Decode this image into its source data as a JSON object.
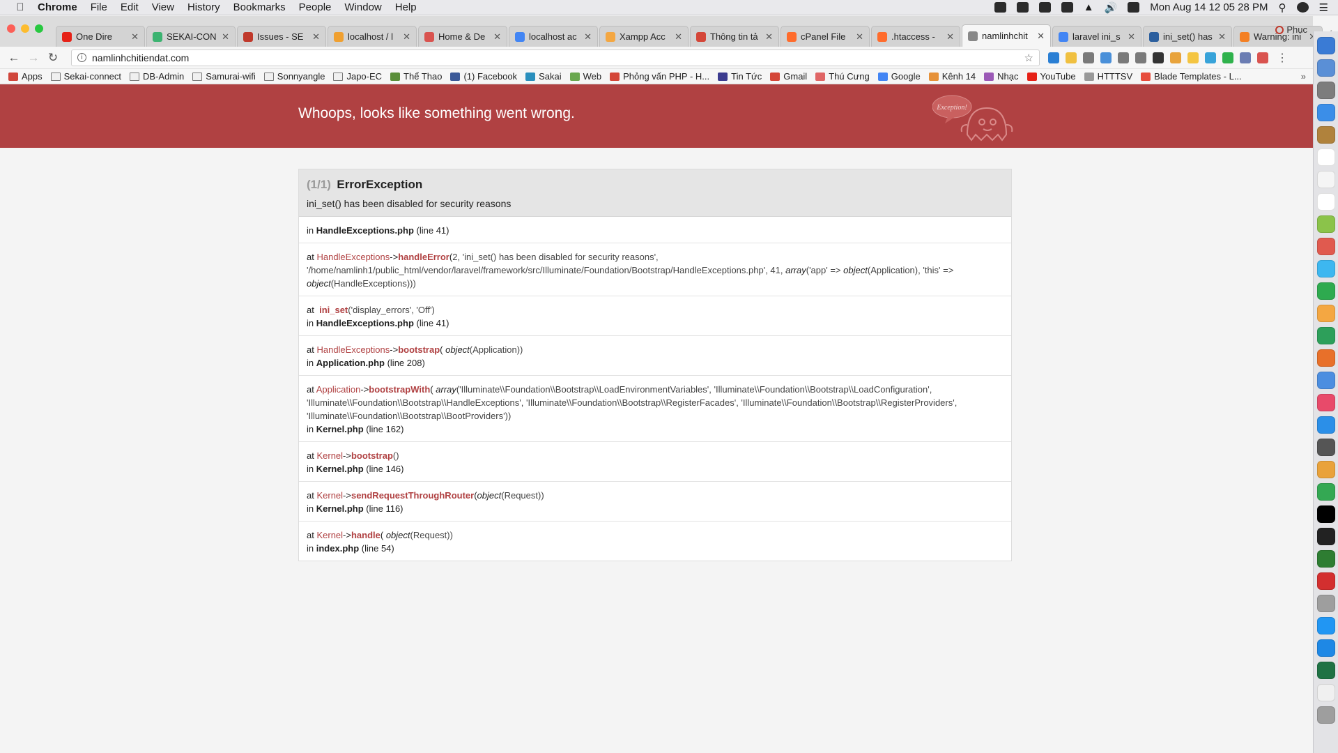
{
  "menubar": {
    "app": "Chrome",
    "items": [
      "File",
      "Edit",
      "View",
      "History",
      "Bookmarks",
      "People",
      "Window",
      "Help"
    ],
    "clock": "Mon Aug 14  12 05 28 PM"
  },
  "tabs": [
    {
      "label": "One Dire",
      "color": "#e62117"
    },
    {
      "label": "SEKAI-CON",
      "color": "#3cb371"
    },
    {
      "label": "Issues - SE",
      "color": "#c0392b"
    },
    {
      "label": "localhost / l",
      "color": "#f0a030"
    },
    {
      "label": "Home & De",
      "color": "#d9534f"
    },
    {
      "label": "localhost ac",
      "color": "#4285f4"
    },
    {
      "label": "Xampp Acc",
      "color": "#f4a742"
    },
    {
      "label": "Thông tin tả",
      "color": "#d44638"
    },
    {
      "label": "cPanel File",
      "color": "#ff6c2c"
    },
    {
      "label": ".htaccess -",
      "color": "#ff6c2c"
    },
    {
      "label": "namlinhchit",
      "color": "#888888",
      "active": true
    },
    {
      "label": "laravel ini_s",
      "color": "#4285f4"
    },
    {
      "label": "ini_set() has",
      "color": "#2c5f9e"
    },
    {
      "label": "Warning: ini",
      "color": "#f48024"
    }
  ],
  "profile_name": "Phuc",
  "address_bar": {
    "url": "namlinhchitiendat.com"
  },
  "bookmarks": [
    {
      "label": "Apps",
      "type": "apps"
    },
    {
      "label": "Sekai-connect",
      "type": "folder"
    },
    {
      "label": "DB-Admin",
      "type": "folder"
    },
    {
      "label": "Samurai-wifi",
      "type": "folder"
    },
    {
      "label": "Sonnyangle",
      "type": "folder"
    },
    {
      "label": "Japo-EC",
      "type": "folder"
    },
    {
      "label": "Thể Thao",
      "type": "site",
      "color": "#5b8f3a"
    },
    {
      "label": "(1) Facebook",
      "type": "site",
      "color": "#3b5998"
    },
    {
      "label": "Sakai",
      "type": "site",
      "color": "#2a8fbd"
    },
    {
      "label": "Web",
      "type": "site",
      "color": "#6aa84f"
    },
    {
      "label": "Phỏng vấn PHP - H...",
      "type": "site",
      "color": "#d44638"
    },
    {
      "label": "Tin Tức",
      "type": "site",
      "color": "#3b3b8f"
    },
    {
      "label": "Gmail",
      "type": "site",
      "color": "#d44638"
    },
    {
      "label": "Thú Cưng",
      "type": "site",
      "color": "#e06666"
    },
    {
      "label": "Google",
      "type": "site",
      "color": "#4285f4"
    },
    {
      "label": "Kênh 14",
      "type": "site",
      "color": "#e69138"
    },
    {
      "label": "Nhạc",
      "type": "site",
      "color": "#9b59b6"
    },
    {
      "label": "YouTube",
      "type": "site",
      "color": "#e62117"
    },
    {
      "label": "HTTTSV",
      "type": "site",
      "color": "#999999"
    },
    {
      "label": "Blade Templates - L...",
      "type": "site",
      "color": "#e74c3c"
    }
  ],
  "error_page": {
    "banner_title": "Whoops, looks like something went wrong.",
    "ghost_caption": "Exception!",
    "exception": {
      "count": "(1/1)",
      "class": "ErrorException",
      "message": "ini_set() has been disabled for security reasons"
    },
    "stack": [
      {
        "type": "in",
        "file": "HandleExceptions.php",
        "line": "(line 41)"
      },
      {
        "type": "call",
        "class": "HandleExceptions",
        "method": "handleError",
        "args_parts": [
          "2, 'ini_set() has been disabled for security reasons',",
          "'/home/namlinh1/public_html/vendor/laravel/framework/src/Illuminate/Foundation/Bootstrap/HandleExceptions.php', 41,",
          "array",
          "('app' =>",
          "object",
          "(Application), 'this' =>",
          "object",
          "(HandleExceptions)))"
        ]
      },
      {
        "type": "func",
        "method": "ini_set",
        "args": "('display_errors', 'Off')",
        "file": "HandleExceptions.php",
        "line": "(line 41)"
      },
      {
        "type": "call2",
        "class": "HandleExceptions",
        "method": "bootstrap",
        "args_obj": "object",
        "args_rest": "(Application))",
        "file": "Application.php",
        "line": "(line 208)"
      },
      {
        "type": "call3",
        "class": "Application",
        "method": "bootstrapWith",
        "args_array": "array",
        "args_text": "('Illuminate\\\\Foundation\\\\Bootstrap\\\\LoadEnvironmentVariables', 'Illuminate\\\\Foundation\\\\Bootstrap\\\\LoadConfiguration', 'Illuminate\\\\Foundation\\\\Bootstrap\\\\HandleExceptions', 'Illuminate\\\\Foundation\\\\Bootstrap\\\\RegisterFacades', 'Illuminate\\\\Foundation\\\\Bootstrap\\\\RegisterProviders', 'Illuminate\\\\Foundation\\\\Bootstrap\\\\BootProviders'))",
        "file": "Kernel.php",
        "line": "(line 162)"
      },
      {
        "type": "call4",
        "class": "Kernel",
        "method": "bootstrap",
        "args": "()",
        "file": "Kernel.php",
        "line": "(line 146)"
      },
      {
        "type": "call2",
        "class": "Kernel",
        "method": "sendRequestThroughRouter",
        "args_obj": "object",
        "args_rest": "(Request))",
        "file": "Kernel.php",
        "line": "(line 116)"
      },
      {
        "type": "call2",
        "class": "Kernel",
        "method": "handle",
        "args_obj": "object",
        "args_rest": "(Request))",
        "file": "index.php",
        "line": "(line 54)"
      }
    ]
  },
  "labels": {
    "at": "at",
    "in": "in",
    "arrow": "->"
  },
  "colors": {
    "banner": "#b04142",
    "accent": "#b04142"
  },
  "dock_colors": [
    "#3a7bd5",
    "#5a8fd6",
    "#7d7d7d",
    "#3b8ee8",
    "#b0823c",
    "#ffffff",
    "#f5f5f5",
    "#ffffff",
    "#8bc34a",
    "#e05a4f",
    "#3db7f0",
    "#2eaa4f",
    "#f4a742",
    "#2d9f5a",
    "#e8702a",
    "#4c8ee0",
    "#e84a6a",
    "#2b8fe8",
    "#555555",
    "#e9a23b",
    "#34a853",
    "#000000",
    "#222222",
    "#2e7d32",
    "#d32f2f",
    "#9e9e9e",
    "#2196f3",
    "#1e88e5",
    "#1f7244",
    "#f0f0f0",
    "#9e9e9e"
  ],
  "ext_colors": [
    "#2a7fd4",
    "#f0c040",
    "#7a7a7a",
    "#4a90d9",
    "#7a7a7a",
    "#7a7a7a",
    "#333333",
    "#e8a33c",
    "#f4c542",
    "#38a3d9",
    "#2fb24c",
    "#6b7db3",
    "#d9534f"
  ]
}
